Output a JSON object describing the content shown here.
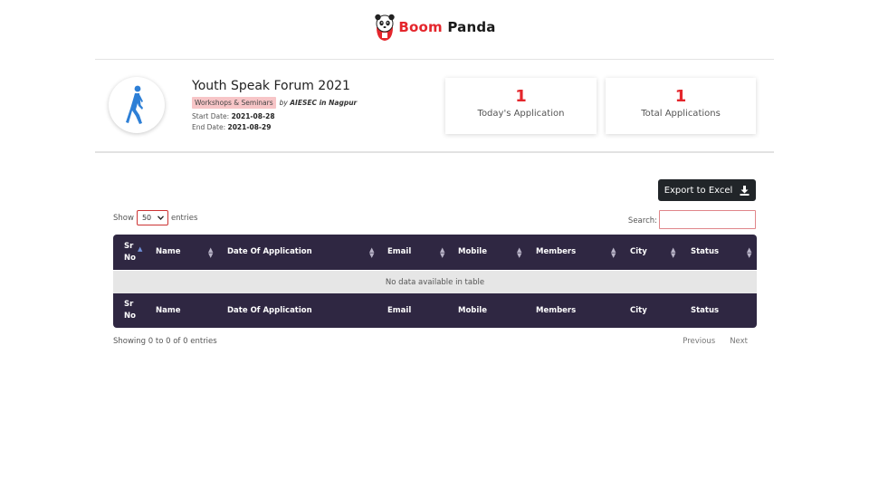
{
  "brand": {
    "word1": "Boom",
    "word2": "Panda"
  },
  "event": {
    "title": "Youth Speak Forum 2021",
    "category": "Workshops & Seminars",
    "by": "by",
    "organizer": "AIESEC in Nagpur",
    "start_label": "Start Date:",
    "start_date": "2021-08-28",
    "end_label": "End Date:",
    "end_date": "2021-08-29"
  },
  "stats": {
    "today": {
      "value": "1",
      "label": "Today's Application"
    },
    "total": {
      "value": "1",
      "label": "Total Applications"
    }
  },
  "toolbar": {
    "export_label": "Export to Excel"
  },
  "table_controls": {
    "show_label": "Show",
    "entries_value": "50",
    "entries_label": "entries",
    "search_label": "Search:",
    "search_value": ""
  },
  "table": {
    "columns": [
      "Sr No",
      "Name",
      "Date Of Application",
      "Email",
      "Mobile",
      "Members",
      "City",
      "Status"
    ],
    "col_sr_line1": "Sr",
    "col_sr_line2": "No",
    "empty_message": "No data available in table"
  },
  "footer": {
    "info": "Showing 0 to 0 of 0 entries",
    "previous": "Previous",
    "next": "Next"
  },
  "colors": {
    "accent": "#e4262c",
    "table_header": "#2f2742",
    "button": "#212529"
  },
  "icons": {
    "logo": "panda-logo-icon",
    "avatar": "walking-person-icon",
    "export": "download-icon",
    "sort": "sort-icon"
  }
}
